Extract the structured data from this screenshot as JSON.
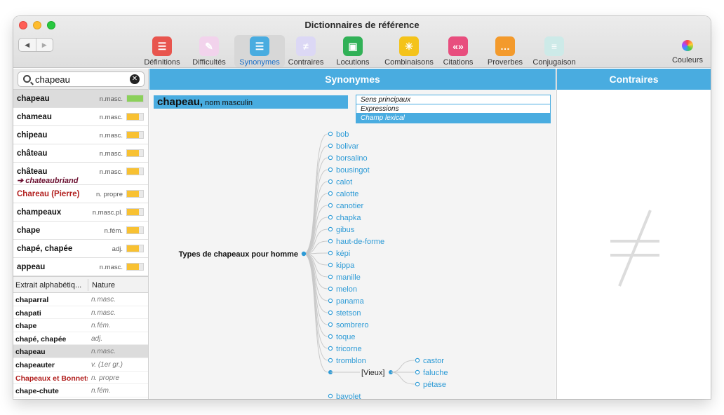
{
  "window": {
    "title": "Dictionnaires de référence"
  },
  "nav": {
    "back": "◀",
    "forward": "▶"
  },
  "toolbar": [
    {
      "id": "definitions",
      "label": "Définitions",
      "color": "#e8554e",
      "glyph": "☰"
    },
    {
      "id": "difficultes",
      "label": "Difficultés",
      "color": "#f2d3ec",
      "glyph": "✎"
    },
    {
      "id": "synonymes",
      "label": "Synonymes",
      "color": "#49ace0",
      "glyph": "☰"
    },
    {
      "id": "contraires",
      "label": "Contraires",
      "color": "#dcd8f5",
      "glyph": "≠"
    },
    {
      "id": "locutions",
      "label": "Locutions",
      "color": "#31b157",
      "glyph": "▣"
    },
    {
      "id": "combinaisons",
      "label": "Combinaisons",
      "color": "#f4c31a",
      "glyph": "✳"
    },
    {
      "id": "citations",
      "label": "Citations",
      "color": "#e84e7e",
      "glyph": "«»"
    },
    {
      "id": "proverbes",
      "label": "Proverbes",
      "color": "#f39a2c",
      "glyph": "…"
    },
    {
      "id": "conjugaison",
      "label": "Conjugaison",
      "color": "#cdeae8",
      "glyph": "≡"
    }
  ],
  "toolbar_colors_label": "Couleurs",
  "search": {
    "value": "chapeau",
    "clear": "✕"
  },
  "word_list": [
    {
      "word": "chapeau",
      "nature": "n.masc.",
      "fill": 1.0,
      "color": "#8bd05a",
      "selected": true
    },
    {
      "word": "chameau",
      "nature": "n.masc.",
      "fill": 0.75,
      "color": "#f8c132"
    },
    {
      "word": "chipeau",
      "nature": "n.masc.",
      "fill": 0.75,
      "color": "#f8c132"
    },
    {
      "word": "château",
      "nature": "n.masc.",
      "fill": 0.75,
      "color": "#f8c132"
    },
    {
      "word": "château",
      "sub": "➔ chateaubriand",
      "nature": "n.masc.",
      "fill": 0.75,
      "color": "#f8c132"
    },
    {
      "word": "Chareau (Pierre)",
      "nature": "n. propre",
      "fill": 0.75,
      "color": "#f8c132",
      "red": true
    },
    {
      "word": "champeaux",
      "nature": "n.masc.pl.",
      "fill": 0.75,
      "color": "#f8c132"
    },
    {
      "word": "chape",
      "nature": "n.fém.",
      "fill": 0.75,
      "color": "#f8c132"
    },
    {
      "word": "chapé, chapée",
      "nature": "adj.",
      "fill": 0.75,
      "color": "#f8c132"
    },
    {
      "word": "appeau",
      "nature": "n.masc.",
      "fill": 0.75,
      "color": "#f8c132"
    }
  ],
  "extract": {
    "col1": "Extrait alphabétiq...",
    "col2": "Nature",
    "rows": [
      {
        "word": "chaparral",
        "nature": "n.masc."
      },
      {
        "word": "chapati",
        "nature": "n.masc."
      },
      {
        "word": "chape",
        "nature": "n.fém."
      },
      {
        "word": "chapé, chapée",
        "nature": "adj."
      },
      {
        "word": "chapeau",
        "nature": "n.masc.",
        "selected": true
      },
      {
        "word": "chapeauter",
        "nature": "v. (1er gr.)"
      },
      {
        "word": "Chapeaux et Bonnets",
        "nature": "n. propre",
        "red": true
      },
      {
        "word": "chape-chute",
        "nature": "n.fém."
      }
    ]
  },
  "synonymes": {
    "header": "Synonymes",
    "headword": "chapeau,",
    "pos": " nom masculin",
    "senses": [
      {
        "label": "Sens principaux",
        "active": false
      },
      {
        "label": "Expressions",
        "active": false
      },
      {
        "label": "Champ lexical",
        "active": true
      }
    ],
    "tree": {
      "root": "Types de chapeaux pour homme",
      "leaves": [
        "bob",
        "bolivar",
        "borsalino",
        "bousingot",
        "calot",
        "calotte",
        "canotier",
        "chapka",
        "gibus",
        "haut-de-forme",
        "képi",
        "kippa",
        "manille",
        "melon",
        "panama",
        "stetson",
        "sombrero",
        "toque",
        "tricorne",
        "tromblon"
      ],
      "sub": {
        "label": "[Vieux]",
        "leaves": [
          "castor",
          "faluche",
          "pétase"
        ]
      },
      "after": [
        "bavolet"
      ]
    }
  },
  "contraires": {
    "header": "Contraires",
    "icon": "not-equal-icon"
  },
  "colors": {
    "accent": "#49ace0",
    "link": "#2e9bd6",
    "red": "#b2201f",
    "grey": "#dcdcdc"
  }
}
